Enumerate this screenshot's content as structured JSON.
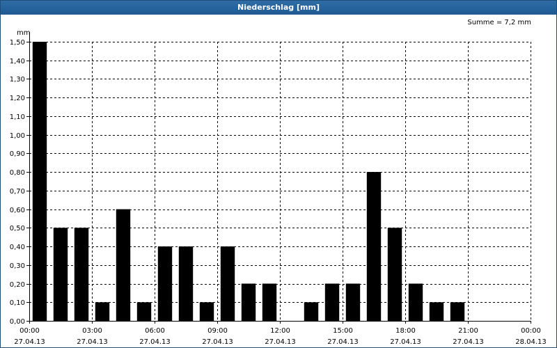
{
  "window": {
    "title": "Niederschlag [mm]"
  },
  "summary": {
    "text": "Summe = 7,2 mm"
  },
  "chart_data": {
    "type": "bar",
    "title": "Niederschlag [mm]",
    "ylabel": "mm",
    "ylim": [
      0,
      1.5
    ],
    "yticks": [
      "0,00",
      "0,10",
      "0,20",
      "0,30",
      "0,40",
      "0,50",
      "0,60",
      "0,70",
      "0,80",
      "0,90",
      "1,00",
      "1,10",
      "1,20",
      "1,30",
      "1,40",
      "1,50"
    ],
    "xticks": [
      {
        "time": "00:00",
        "date": "27.04.13"
      },
      {
        "time": "03:00",
        "date": "27.04.13"
      },
      {
        "time": "06:00",
        "date": "27.04.13"
      },
      {
        "time": "09:00",
        "date": "27.04.13"
      },
      {
        "time": "12:00",
        "date": "27.04.13"
      },
      {
        "time": "15:00",
        "date": "27.04.13"
      },
      {
        "time": "18:00",
        "date": "27.04.13"
      },
      {
        "time": "21:00",
        "date": "27.04.13"
      },
      {
        "time": "00:00",
        "date": "28.04.13"
      }
    ],
    "hours": [
      "00:00",
      "01:00",
      "02:00",
      "03:00",
      "04:00",
      "05:00",
      "06:00",
      "07:00",
      "08:00",
      "09:00",
      "10:00",
      "11:00",
      "12:00",
      "13:00",
      "14:00",
      "15:00",
      "16:00",
      "17:00",
      "18:00",
      "19:00",
      "20:00",
      "21:00",
      "22:00",
      "23:00"
    ],
    "values": [
      1.5,
      0.5,
      0.5,
      0.1,
      0.6,
      0.1,
      0.4,
      0.4,
      0.1,
      0.4,
      0.2,
      0.2,
      0.0,
      0.1,
      0.2,
      0.2,
      0.8,
      0.5,
      0.2,
      0.1,
      0.1,
      0.0,
      0.0,
      0.0
    ],
    "grid": true,
    "bar_color": "#000000",
    "grid_color": "#000000"
  }
}
